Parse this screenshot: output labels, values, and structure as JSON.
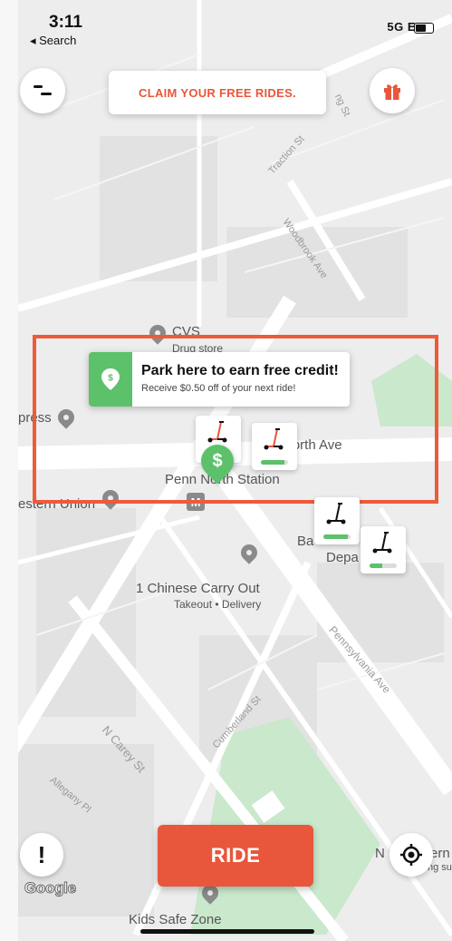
{
  "status_bar": {
    "time": "3:11",
    "back_label": "◂ Search",
    "signal": "5G E"
  },
  "top": {
    "claim_label": "CLAIM YOUR FREE RIDES."
  },
  "map": {
    "streets": [
      "Traction St",
      "Woodbrook Ave",
      "North Ave",
      "Pennsylvania Ave",
      "Cumberland St",
      "N Carey St",
      "Allegany Pl",
      "ng St"
    ],
    "places": {
      "cvs": {
        "name": "CVS",
        "type": "Drug store"
      },
      "express": "press",
      "penn_station": "Penn North Station",
      "western_union": "estern Union",
      "chinese": {
        "name": "1 Chinese Carry Out",
        "sub": "Takeout • Delivery"
      },
      "ba": "Ba",
      "depa": "Depa",
      "kids": "Kids Safe Zone",
      "right_edge_1": "N",
      "right_edge_2": "ern",
      "right_edge_3": "ng su"
    }
  },
  "tooltip": {
    "title": "Park here to earn free credit!",
    "subtitle": "Receive $0.50 off of your next ride!"
  },
  "scooters": [
    {
      "battery": 0.8
    },
    {
      "battery": 0.85
    },
    {
      "battery": 0.9
    },
    {
      "battery": 0.45
    }
  ],
  "parking_pin": "$",
  "bottom": {
    "ride_label": "RIDE",
    "google": "Google"
  },
  "colors": {
    "accent": "#e8563b",
    "green": "#5cc16a",
    "map": "#ececec"
  },
  "icons": [
    "menu-icon",
    "gift-icon",
    "dollar-icon",
    "scooter-icon",
    "alert-icon",
    "crosshair-icon",
    "location-pin-icon",
    "metro-icon",
    "restaurant-icon"
  ]
}
